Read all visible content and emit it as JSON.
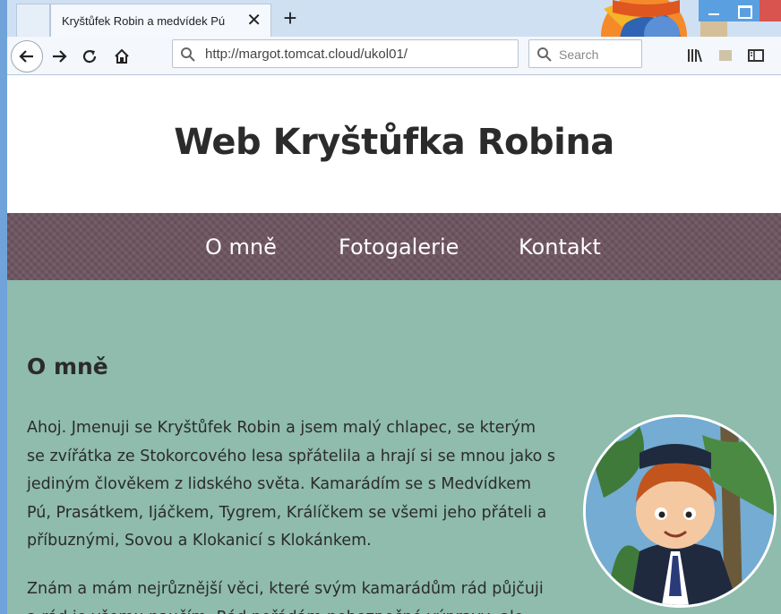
{
  "browser": {
    "tab_title": "Kryštůfek Robin a medvídek Pú",
    "tab_close": "✕",
    "new_tab": "+",
    "url": "http://margot.tomcat.cloud/ukol01/",
    "search_placeholder": "Search"
  },
  "site": {
    "title": "Web Kryštůfka Robina",
    "menu": [
      "O mně",
      "Fotogalerie",
      "Kontakt"
    ],
    "section_heading": "O mně",
    "paragraphs": [
      "Ahoj. Jmenuji se Kryštůfek Robin a jsem malý chlapec, se kterým se zvířátka ze Stokorcového lesa spřátelila a hrají si se mnou jako s jediným člověkem z lidského světa. Kamarádím se s Medvídkem Pú, Prasátkem, Ijáčkem, Tygrem, Králíčkem se všemi jeho přáteli a příbuznými, Sovou a Klokanicí s Klokánkem.",
      "Znám a mám nejrůznější věci, které svým kamarádům rád půjčuji a rád je všemu naučím. Rád pořádám nebezpečné výpravy, ale"
    ]
  },
  "colors": {
    "menu_bg": "#6e5560",
    "content_bg": "#8fbcac",
    "heading_text": "#2b2b2b"
  }
}
